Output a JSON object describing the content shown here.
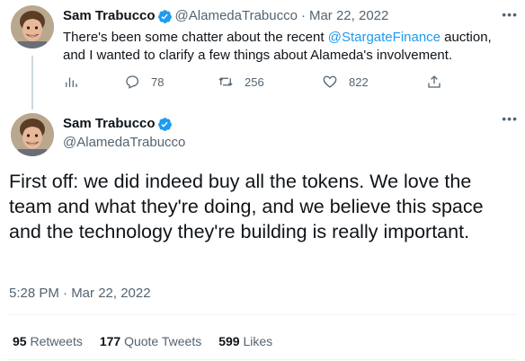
{
  "tweet_reply": {
    "name": "Sam Trabucco",
    "handle": "@AlamedaTrabucco",
    "date": "Mar 22, 2022",
    "text_before": "There's been some chatter about the recent ",
    "mention": "@StargateFinance",
    "text_after": " auction, and I wanted to clarify a few things about Alameda's involvement.",
    "replies": "78",
    "retweets": "256",
    "likes": "822"
  },
  "tweet_main": {
    "name": "Sam Trabucco",
    "handle": "@AlamedaTrabucco",
    "text": "First off: we did indeed buy all the tokens. We love the team and what they're doing, and we believe this space and the technology they're building is really important.",
    "timestamp": "5:28 PM · Mar 22, 2022"
  },
  "stats": {
    "retweets_count": "95",
    "retweets_label": "Retweets",
    "quotes_count": "177",
    "quotes_label": "Quote Tweets",
    "likes_count": "599",
    "likes_label": "Likes"
  },
  "icons": {
    "verified": "verified-badge-icon",
    "more": "more-icon",
    "analytics": "analytics-icon",
    "reply": "reply-icon",
    "retweet": "retweet-icon",
    "like": "heart-icon",
    "share": "share-icon"
  },
  "colors": {
    "accent": "#1d9bf0",
    "text": "#0f1419",
    "secondary": "#536471"
  }
}
